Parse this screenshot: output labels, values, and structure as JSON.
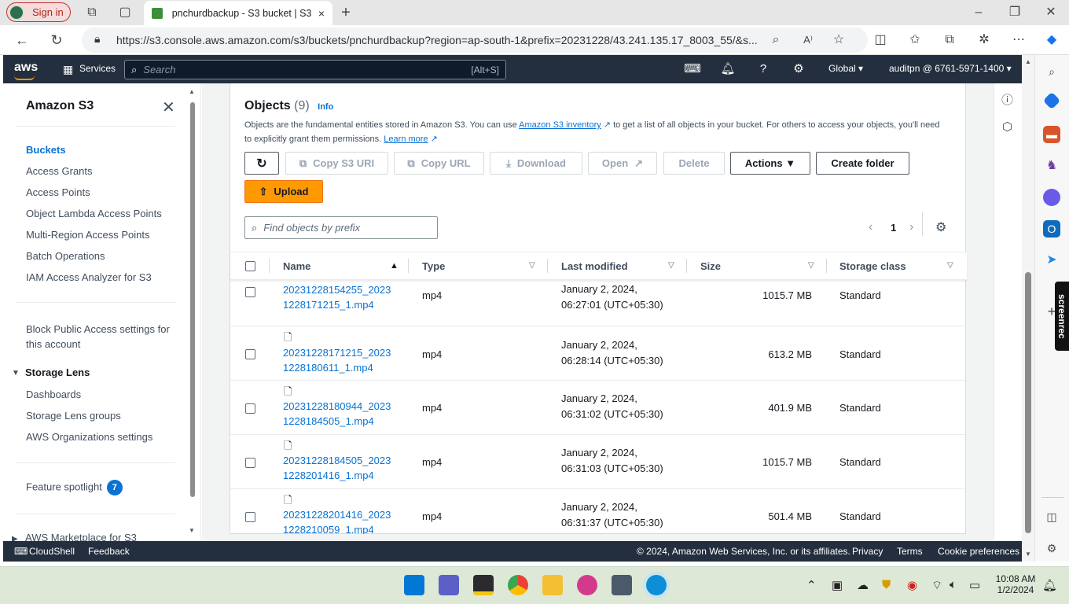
{
  "browser": {
    "sign_in": "Sign in",
    "tab_title": "pnchurdbackup - S3 bucket | S3",
    "tab_close": "×",
    "new_tab": "+",
    "url": "https://s3.console.aws.amazon.com/s3/buckets/pnchurdbackup?region=ap-south-1&prefix=20231228/43.241.135.17_8003_55/&s...",
    "window_controls": [
      "–",
      "❐",
      "✕"
    ]
  },
  "aws": {
    "logo": "aws",
    "services": "Services",
    "search_placeholder": "Search",
    "search_shortcut": "[Alt+S]",
    "region": "Global ▾",
    "account": "auditpn @ 6761-5971-1400 ▾"
  },
  "sidebar": {
    "title": "Amazon S3",
    "items": [
      "Buckets",
      "Access Grants",
      "Access Points",
      "Object Lambda Access Points",
      "Multi-Region Access Points",
      "Batch Operations",
      "IAM Access Analyzer for S3"
    ],
    "block_public_line1": "Block Public Access settings for",
    "block_public_line2": "this account",
    "storage_lens": "Storage Lens",
    "lens_items": [
      "Dashboards",
      "Storage Lens groups",
      "AWS Organizations settings"
    ],
    "feature_spotlight": "Feature spotlight",
    "spotlight_count": "7",
    "marketplace": "AWS Marketplace for S3"
  },
  "objects": {
    "title": "Objects",
    "count": "(9)",
    "info": "Info",
    "desc_1": "Objects are the fundamental entities stored in Amazon S3. You can use ",
    "desc_link1": "Amazon S3 inventory",
    "desc_2": " to get a list of all objects in your bucket. For others to access your objects, you'll need",
    "desc_3": "to explicitly grant them permissions. ",
    "desc_link2": "Learn more",
    "buttons": {
      "copy_s3_uri": "Copy S3 URI",
      "copy_url": "Copy URL",
      "download": "Download",
      "open": "Open",
      "delete": "Delete",
      "actions": "Actions ▼",
      "create_folder": "Create folder",
      "upload": "Upload"
    },
    "find_placeholder": "Find objects by prefix",
    "page": "1",
    "columns": [
      "Name",
      "Type",
      "Last modified",
      "Size",
      "Storage class"
    ],
    "rows": [
      {
        "name1": "20231228154255_2023",
        "name2": "1228171215_1.mp4",
        "type": "mp4",
        "mod1": "January 2, 2024,",
        "mod2": "06:27:01 (UTC+05:30)",
        "size": "1015.7 MB",
        "class": "Standard"
      },
      {
        "name1": "20231228171215_2023",
        "name2": "1228180611_1.mp4",
        "type": "mp4",
        "mod1": "January 2, 2024,",
        "mod2": "06:28:14 (UTC+05:30)",
        "size": "613.2 MB",
        "class": "Standard"
      },
      {
        "name1": "20231228180944_2023",
        "name2": "1228184505_1.mp4",
        "type": "mp4",
        "mod1": "January 2, 2024,",
        "mod2": "06:31:02 (UTC+05:30)",
        "size": "401.9 MB",
        "class": "Standard"
      },
      {
        "name1": "20231228184505_2023",
        "name2": "1228201416_1.mp4",
        "type": "mp4",
        "mod1": "January 2, 2024,",
        "mod2": "06:31:03 (UTC+05:30)",
        "size": "1015.7 MB",
        "class": "Standard"
      },
      {
        "name1": "20231228201416_2023",
        "name2": "1228210059_1.mp4",
        "type": "mp4",
        "mod1": "January 2, 2024,",
        "mod2": "06:31:37 (UTC+05:30)",
        "size": "501.4 MB",
        "class": "Standard"
      }
    ]
  },
  "footer": {
    "cloudshell": "CloudShell",
    "feedback": "Feedback",
    "copyright": "© 2024, Amazon Web Services, Inc. or its affiliates.",
    "privacy": "Privacy",
    "terms": "Terms",
    "cookie": "Cookie preferences"
  },
  "screenrec": "screenrec",
  "taskbar": {
    "time": "10:08 AM",
    "date": "1/2/2024"
  },
  "colors": {
    "aws_nav": "#232f3e",
    "accent_orange": "#ff9900",
    "link_blue": "#0972d3"
  }
}
